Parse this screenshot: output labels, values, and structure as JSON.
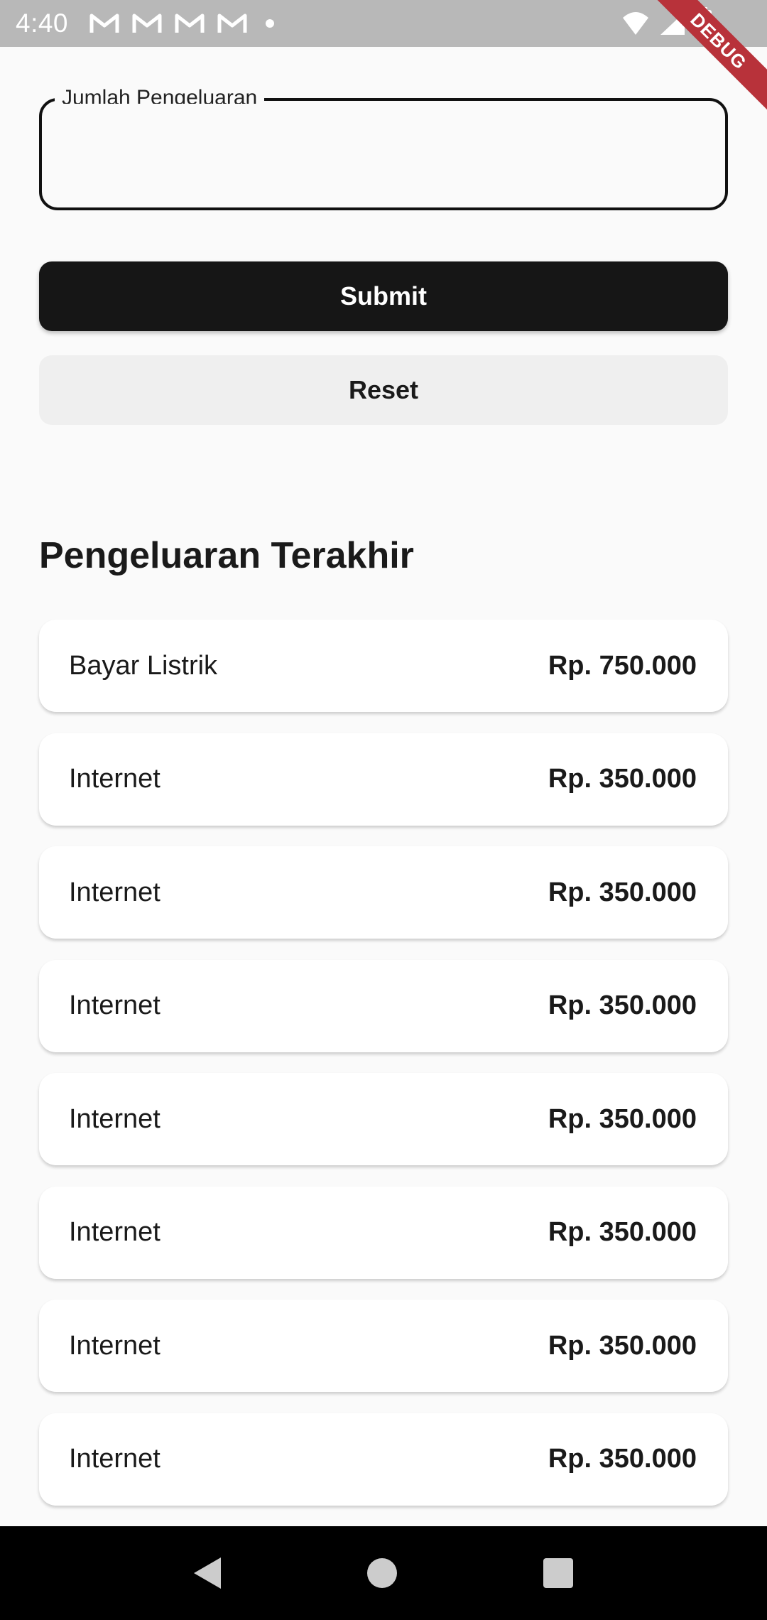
{
  "status_bar": {
    "time": "4:40",
    "notification_icons": [
      "gmail-icon",
      "gmail-icon",
      "gmail-icon",
      "gmail-icon",
      "dot-icon"
    ],
    "system_icons": [
      "wifi-icon",
      "signal-icon",
      "battery-icon"
    ]
  },
  "debug_banner": "DEBUG",
  "form": {
    "amount_label": "Jumlah Pengeluaran",
    "amount_value": "",
    "submit_label": "Submit",
    "reset_label": "Reset"
  },
  "recent": {
    "title": "Pengeluaran Terakhir",
    "items": [
      {
        "name": "Bayar Listrik",
        "amount": "Rp. 750.000"
      },
      {
        "name": "Internet",
        "amount": "Rp. 350.000"
      },
      {
        "name": "Internet",
        "amount": "Rp. 350.000"
      },
      {
        "name": "Internet",
        "amount": "Rp. 350.000"
      },
      {
        "name": "Internet",
        "amount": "Rp. 350.000"
      },
      {
        "name": "Internet",
        "amount": "Rp. 350.000"
      },
      {
        "name": "Internet",
        "amount": "Rp. 350.000"
      },
      {
        "name": "Internet",
        "amount": "Rp. 350.000"
      }
    ]
  },
  "nav_bar": {
    "icons": [
      "back-icon",
      "home-icon",
      "recents-icon"
    ]
  }
}
